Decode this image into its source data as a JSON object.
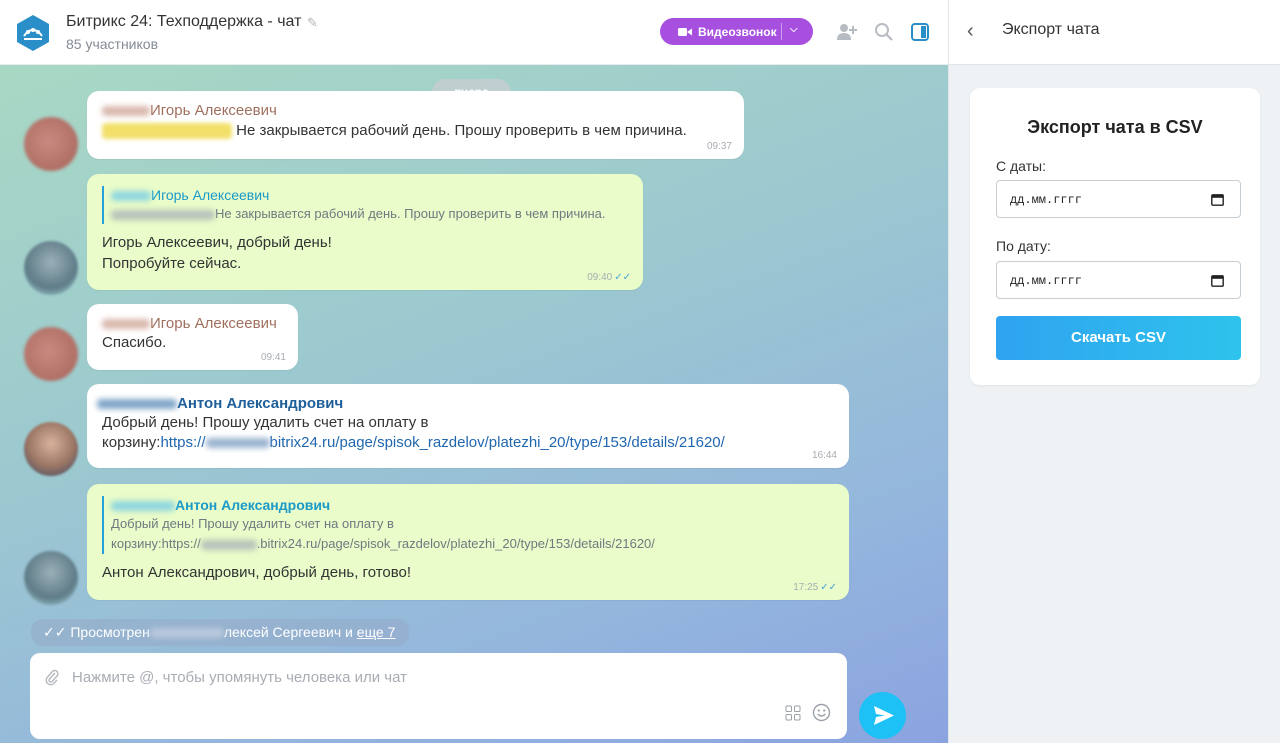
{
  "header": {
    "title": "Битрикс 24: Техподдержка - чат",
    "subtitle": "85 участников",
    "video_call_label": "Видеозвонок"
  },
  "chat": {
    "date_divider": "вчера",
    "messages": [
      {
        "author": "Игорь Алексеевич",
        "text": "Не закрывается рабочий день. Прошу проверить в чем причина.",
        "time": "09:37"
      },
      {
        "quote_author": "Игорь Алексеевич",
        "quote_text": "Не закрывается рабочий день. Прошу проверить в чем причина.",
        "line1": "Игорь Алексеевич, добрый день!",
        "line2": "Попробуйте сейчас.",
        "time": "09:40"
      },
      {
        "author": "Игорь Алексеевич",
        "text": "Спасибо.",
        "time": "09:41"
      },
      {
        "author": "Антон Александрович",
        "line1": "Добрый день! Прошу удалить счет на оплату в",
        "line2_prefix": "корзину:",
        "link_start": "https://",
        "link_end": "bitrix24.ru/page/spisok_razdelov/platezhi_20/type/153/details/21620/",
        "time": "16:44"
      },
      {
        "quote_author": "Антон Александрович",
        "quote_line1": "Добрый день! Прошу удалить счет на оплату в",
        "quote_line2a": "корзину:https://",
        "quote_line2b": ".bitrix24.ru/page/spisok_razdelov/platezhi_20/type/153/details/21620/",
        "text": "Антон Александрович, добрый день, готово!",
        "time": "17:25"
      }
    ],
    "viewed_prefix": "Просмотрен",
    "viewed_name": "лексей Сергеевич и",
    "viewed_more": "еще 7",
    "composer_placeholder": "Нажмите @, чтобы упомянуть человека или чат"
  },
  "export_panel": {
    "title": "Экспорт чата",
    "card_title": "Экспорт чата в CSV",
    "from_label": "С даты:",
    "to_label": "По дату:",
    "date_placeholder": "дд.мм.гггг",
    "download_label": "Скачать CSV"
  },
  "colors": {
    "accent_purple": "#a750e0",
    "send_blue": "#1ec1f5",
    "outgoing_bubble": "#e9fcc9"
  }
}
